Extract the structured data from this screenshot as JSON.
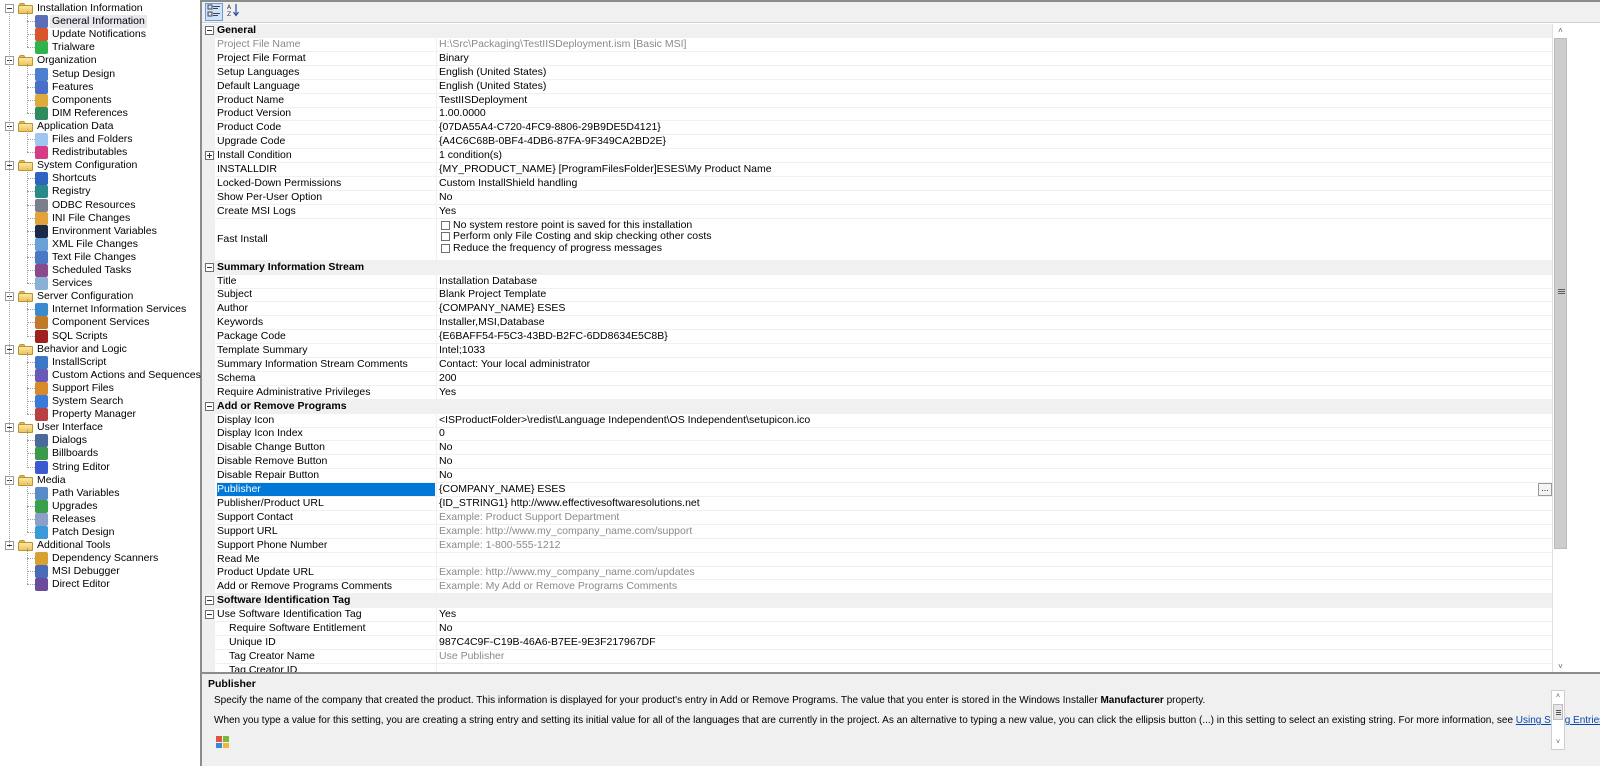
{
  "tree": {
    "groups": [
      {
        "label": "Installation Information",
        "children": [
          {
            "label": "General Information",
            "icon": "general-information-icon",
            "color": "#5a6fb8",
            "selected": true
          },
          {
            "label": "Update Notifications",
            "icon": "update-notifications-icon",
            "color": "#d9532c"
          },
          {
            "label": "Trialware",
            "icon": "trialware-icon",
            "color": "#2fb34a"
          }
        ]
      },
      {
        "label": "Organization",
        "children": [
          {
            "label": "Setup Design",
            "icon": "setup-design-icon",
            "color": "#4c7fd1"
          },
          {
            "label": "Features",
            "icon": "features-icon",
            "color": "#4a6fc9"
          },
          {
            "label": "Components",
            "icon": "components-icon",
            "color": "#e0a93c"
          },
          {
            "label": "DIM References",
            "icon": "dim-references-icon",
            "color": "#2f8a5e"
          }
        ]
      },
      {
        "label": "Application Data",
        "children": [
          {
            "label": "Files and Folders",
            "icon": "files-and-folders-icon",
            "color": "#9ec6ee"
          },
          {
            "label": "Redistributables",
            "icon": "redistributables-icon",
            "color": "#d63c86"
          }
        ]
      },
      {
        "label": "System Configuration",
        "children": [
          {
            "label": "Shortcuts",
            "icon": "shortcuts-icon",
            "color": "#2e63c2"
          },
          {
            "label": "Registry",
            "icon": "registry-icon",
            "color": "#2a8a8a"
          },
          {
            "label": "ODBC Resources",
            "icon": "odbc-resources-icon",
            "color": "#7a7f8c"
          },
          {
            "label": "INI File Changes",
            "icon": "ini-file-changes-icon",
            "color": "#e3a13a"
          },
          {
            "label": "Environment Variables",
            "icon": "environment-variables-icon",
            "color": "#1c2a4a"
          },
          {
            "label": "XML File Changes",
            "icon": "xml-file-changes-icon",
            "color": "#6aa0d8"
          },
          {
            "label": "Text File Changes",
            "icon": "text-file-changes-icon",
            "color": "#4a78c4"
          },
          {
            "label": "Scheduled Tasks",
            "icon": "scheduled-tasks-icon",
            "color": "#8a4a8a"
          },
          {
            "label": "Services",
            "icon": "services-icon",
            "color": "#8ab0d8"
          }
        ]
      },
      {
        "label": "Server Configuration",
        "children": [
          {
            "label": "Internet Information Services",
            "icon": "iis-icon",
            "color": "#3a8ad0"
          },
          {
            "label": "Component Services",
            "icon": "component-services-icon",
            "color": "#c07a28"
          },
          {
            "label": "SQL Scripts",
            "icon": "sql-scripts-icon",
            "color": "#a02020"
          }
        ]
      },
      {
        "label": "Behavior and Logic",
        "children": [
          {
            "label": "InstallScript",
            "icon": "installscript-icon",
            "color": "#3d78c8"
          },
          {
            "label": "Custom Actions and Sequences",
            "icon": "custom-actions-icon",
            "color": "#6a5ab8"
          },
          {
            "label": "Support Files",
            "icon": "support-files-icon",
            "color": "#d88a2a"
          },
          {
            "label": "System Search",
            "icon": "system-search-icon",
            "color": "#3a7ad8"
          },
          {
            "label": "Property Manager",
            "icon": "property-manager-icon",
            "color": "#b84040"
          }
        ]
      },
      {
        "label": "User Interface",
        "children": [
          {
            "label": "Dialogs",
            "icon": "dialogs-icon",
            "color": "#4a6a9a"
          },
          {
            "label": "Billboards",
            "icon": "billboards-icon",
            "color": "#3a9a4a"
          },
          {
            "label": "String Editor",
            "icon": "string-editor-icon",
            "color": "#3a5ad0"
          }
        ]
      },
      {
        "label": "Media",
        "children": [
          {
            "label": "Path Variables",
            "icon": "path-variables-icon",
            "color": "#5a8ac8"
          },
          {
            "label": "Upgrades",
            "icon": "upgrades-icon",
            "color": "#3aa04a"
          },
          {
            "label": "Releases",
            "icon": "releases-icon",
            "color": "#8aa0c8"
          },
          {
            "label": "Patch Design",
            "icon": "patch-design-icon",
            "color": "#3a9ad8"
          }
        ]
      },
      {
        "label": "Additional Tools",
        "children": [
          {
            "label": "Dependency Scanners",
            "icon": "dependency-scanners-icon",
            "color": "#d8a030"
          },
          {
            "label": "MSI Debugger",
            "icon": "msi-debugger-icon",
            "color": "#4a6ab8"
          },
          {
            "label": "Direct Editor",
            "icon": "direct-editor-icon",
            "color": "#6a4a9a"
          }
        ]
      }
    ]
  },
  "toolbar": {
    "categorized_label": "categorized",
    "alphabetical_label": "A↓Z"
  },
  "grid": {
    "categories": [
      {
        "title": "General",
        "rows": [
          {
            "name": "Project File Name",
            "value": "H:\\Src\\Packaging\\TestIISDeployment.ism [Basic MSI]",
            "readonly": true
          },
          {
            "name": "Project File Format",
            "value": "Binary"
          },
          {
            "name": "Setup Languages",
            "value": "English (United States)"
          },
          {
            "name": "Default Language",
            "value": "English (United States)"
          },
          {
            "name": "Product Name",
            "value": "TestIISDeployment"
          },
          {
            "name": "Product Version",
            "value": "1.00.0000"
          },
          {
            "name": "Product Code",
            "value": "{07DA55A4-C720-4FC9-8806-29B9DE5D4121}"
          },
          {
            "name": "Upgrade Code",
            "value": "{A4C6C68B-0BF4-4DB6-87FA-9F349CA2BD2E}"
          },
          {
            "name": "Install Condition",
            "value": "1 condition(s)",
            "expandable": true
          },
          {
            "name": "INSTALLDIR",
            "value": "{MY_PRODUCT_NAME} [ProgramFilesFolder]ESES\\My Product Name"
          },
          {
            "name": "Locked-Down Permissions",
            "value": "Custom InstallShield handling"
          },
          {
            "name": "Show Per-User Option",
            "value": "No"
          },
          {
            "name": "Create MSI Logs",
            "value": "Yes"
          },
          {
            "name": "Fast Install",
            "checkboxes": [
              {
                "label": "No system restore point is saved for this installation",
                "checked": false
              },
              {
                "label": "Perform only File Costing and skip checking other costs",
                "checked": false
              },
              {
                "label": "Reduce the frequency of progress messages",
                "checked": false
              }
            ]
          }
        ]
      },
      {
        "title": "Summary Information Stream",
        "rows": [
          {
            "name": "Title",
            "value": "Installation Database"
          },
          {
            "name": "Subject",
            "value": "Blank Project Template"
          },
          {
            "name": "Author",
            "value": "{COMPANY_NAME} ESES"
          },
          {
            "name": "Keywords",
            "value": "Installer,MSI,Database"
          },
          {
            "name": "Package Code",
            "value": "{E6BAFF54-F5C3-43BD-B2FC-6DD8634E5C8B}"
          },
          {
            "name": "Template Summary",
            "value": "Intel;1033"
          },
          {
            "name": "Summary Information Stream Comments",
            "value": "Contact:  Your local administrator"
          },
          {
            "name": "Schema",
            "value": "200"
          },
          {
            "name": "Require Administrative Privileges",
            "value": "Yes"
          }
        ]
      },
      {
        "title": "Add or Remove Programs",
        "rows": [
          {
            "name": "Display Icon",
            "value": "<ISProductFolder>\\redist\\Language Independent\\OS Independent\\setupicon.ico"
          },
          {
            "name": "Display Icon Index",
            "value": "0"
          },
          {
            "name": "Disable Change Button",
            "value": "No"
          },
          {
            "name": "Disable Remove Button",
            "value": "No"
          },
          {
            "name": "Disable Repair Button",
            "value": "No"
          },
          {
            "name": "Publisher",
            "value": "{COMPANY_NAME} ESES",
            "selected": true,
            "ellipsis": "..."
          },
          {
            "name": "Publisher/Product URL",
            "value": "{ID_STRING1} http://www.effectivesoftwaresolutions.net"
          },
          {
            "name": "Support Contact",
            "value": "Example: Product Support Department",
            "hint": true
          },
          {
            "name": "Support URL",
            "value": "Example: http://www.my_company_name.com/support",
            "hint": true
          },
          {
            "name": "Support Phone Number",
            "value": "Example: 1-800-555-1212",
            "hint": true
          },
          {
            "name": "Read Me",
            "value": ""
          },
          {
            "name": "Product Update URL",
            "value": "Example: http://www.my_company_name.com/updates",
            "hint": true
          },
          {
            "name": "Add or Remove Programs Comments",
            "value": "Example: My Add or Remove Programs Comments",
            "hint": true
          }
        ]
      },
      {
        "title": "Software Identification Tag",
        "rows": [
          {
            "name": "Use Software Identification Tag",
            "value": "Yes",
            "collapsible": true
          },
          {
            "name": "Require Software Entitlement",
            "value": "No",
            "indent": true
          },
          {
            "name": "Unique ID",
            "value": "987C4C9F-C19B-46A6-B7EE-9E3F217967DF",
            "indent": true
          },
          {
            "name": "Tag Creator Name",
            "value": "Use Publisher",
            "indent": true,
            "hint": true
          },
          {
            "name": "Tag Creator ID",
            "value": "",
            "indent": true
          }
        ]
      }
    ]
  },
  "description": {
    "title": "Publisher",
    "p1_before": "Specify the name of the company that created the product. This information is displayed for your product's entry in Add or Remove Programs. The value that you enter is stored in the Windows Installer ",
    "p1_bold": "Manufacturer",
    "p1_after": " property.",
    "p2_before": "When you type a value for this setting, you are creating a string entry and setting its initial value for all of the languages that are currently in the project. As an alternative to typing a new value, you can click the ellipsis button (...) in this setting to select an existing string. For more information, see ",
    "p2_link": "Using String Entries in InstallShield",
    "p2_after": "."
  },
  "colors": {
    "selection": "#0078d7",
    "category_bg": "#f0f0f0",
    "hint_text": "#8a8a8a",
    "link": "#0645ad"
  }
}
